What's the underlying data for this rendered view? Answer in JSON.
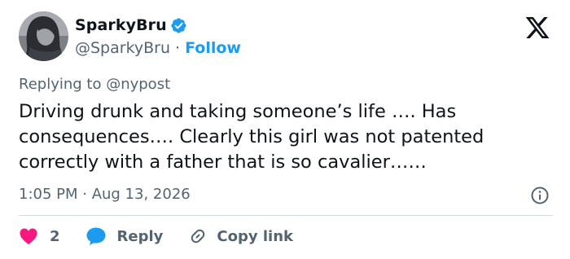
{
  "author": {
    "display_name": "SparkyBru",
    "handle": "@SparkyBru",
    "separator": "·",
    "follow_label": "Follow",
    "verified_color": "#1d9bf0"
  },
  "tweet": {
    "replying_to": "Replying to @nypost",
    "text": "Driving drunk and taking someone’s life …. Has consequences…. Clearly this girl was not patented correctly with a father that is so cavalier……",
    "timestamp": "1:05 PM · Aug 13, 2026"
  },
  "actions": {
    "like_count": "2",
    "reply_label": "Reply",
    "copy_link_label": "Copy link",
    "like_color": "#f91880",
    "reply_color": "#1d9bf0"
  },
  "icons": {
    "platform_logo": "x-logo-icon",
    "info": "info-icon",
    "like": "heart-icon",
    "reply": "chat-bubble-icon",
    "copy_link": "link-icon"
  }
}
